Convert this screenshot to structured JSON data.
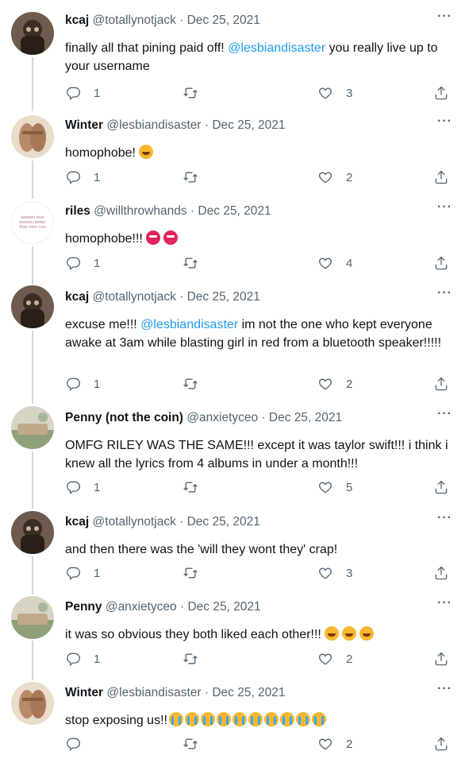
{
  "tweets": [
    {
      "name": "kcaj",
      "handle": "@totallynotjack",
      "date": "Dec 25, 2021",
      "text_before": "finally all that pining paid off! ",
      "mention": "@lesbiandisaster",
      "text_after": " you really live up to your username",
      "emojis": [],
      "replies": "1",
      "likes": "3",
      "avatar": "kcaj"
    },
    {
      "name": "Winter",
      "handle": "@lesbiandisaster",
      "date": "Dec 25, 2021",
      "text_before": "homophobe!",
      "mention": "",
      "text_after": "",
      "emojis": [
        "rofl"
      ],
      "replies": "1",
      "likes": "2",
      "avatar": "winter"
    },
    {
      "name": "riles",
      "handle": "@willthrowhands",
      "date": "Dec 25, 2021",
      "text_before": "homophobe!!!",
      "mention": "",
      "text_after": "",
      "emojis": [
        "angry",
        "angry"
      ],
      "replies": "1",
      "likes": "4",
      "avatar": "riles",
      "avatar_text": "women love women better than men can"
    },
    {
      "name": "kcaj",
      "handle": "@totallynotjack",
      "date": "Dec 25, 2021",
      "text_before": "excuse me!!! ",
      "mention": "@lesbiandisaster",
      "text_after": " im not the one who kept everyone awake at 3am while blasting girl in red from a bluetooth speaker!!!!!",
      "emojis": [],
      "replies": "1",
      "likes": "2",
      "avatar": "kcaj"
    },
    {
      "name": "Penny (not the coin)",
      "handle": "@anxietyceo",
      "date": "Dec 25, 2021",
      "text_before": "OMFG RILEY WAS THE SAME!!! except it was taylor swift!!! i think i knew all the lyrics from 4 albums in under a month!!!",
      "mention": "",
      "text_after": "",
      "emojis": [],
      "replies": "1",
      "likes": "5",
      "avatar": "penny"
    },
    {
      "name": "kcaj",
      "handle": "@totallynotjack",
      "date": "Dec 25, 2021",
      "text_before": "and then there was the 'will they wont they' crap!",
      "mention": "",
      "text_after": "",
      "emojis": [],
      "replies": "1",
      "likes": "3",
      "avatar": "kcaj"
    },
    {
      "name": "Penny",
      "handle": "@anxietyceo",
      "date": "Dec 25, 2021",
      "text_before": "it was so obvious they both liked each other!!!",
      "mention": "",
      "text_after": "",
      "emojis": [
        "rofl",
        "rofl",
        "rofl"
      ],
      "replies": "1",
      "likes": "2",
      "avatar": "penny"
    },
    {
      "name": "Winter",
      "handle": "@lesbiandisaster",
      "date": "Dec 25, 2021",
      "text_before": "stop exposing us!!",
      "mention": "",
      "text_after": "",
      "emojis": [
        "sob",
        "sob",
        "sob",
        "sob",
        "sob",
        "sob",
        "sob",
        "sob",
        "sob",
        "sob"
      ],
      "replies": "",
      "likes": "2",
      "avatar": "winter"
    }
  ],
  "colors": {
    "text": "#0f1419",
    "muted": "#536471",
    "link": "#1d9bf0",
    "line": "#cfd9de"
  },
  "icons": {
    "reply": "reply-icon",
    "retweet": "retweet-icon",
    "like": "heart-icon",
    "share": "share-icon",
    "more": "more-icon"
  }
}
